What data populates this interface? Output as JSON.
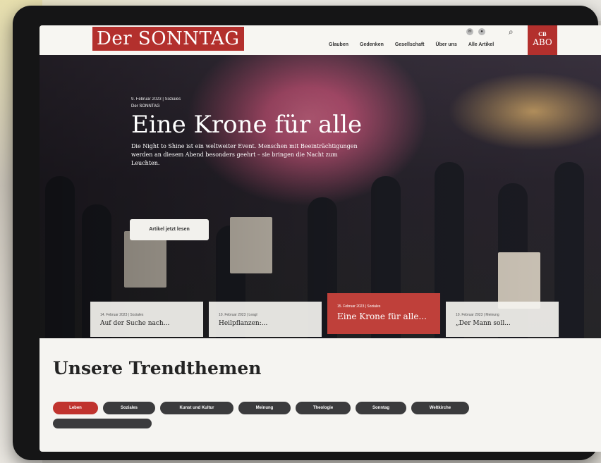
{
  "colors": {
    "brand": "#b3302d",
    "chip_dark": "#3b3b3d"
  },
  "header": {
    "logo": "Der SONNTAG",
    "nav": [
      "Glauben",
      "Gedenken",
      "Gesellschaft",
      "Über uns",
      "Alle Artikel"
    ],
    "abo": {
      "top": "CB",
      "bottom": "ABO"
    }
  },
  "hero": {
    "meta": "9. Februar 2023 | Soziales",
    "author": "Der SONNTAG",
    "title": "Eine Krone für alle",
    "description": "Die Night to Shine ist ein weltweiter Event. Menschen mit Beeinträchtigungen werden an diesem Abend besonders geehrt – sie bringen die Nacht zum Leuchten.",
    "button": "Artikel jetzt lesen"
  },
  "cards": [
    {
      "meta": "14. Februar 2023 | Soziales",
      "title": "Auf der Suche nach..."
    },
    {
      "meta": "10. Februar 2023 | Leagl",
      "title": "Heilpflanzen:..."
    },
    {
      "meta": "15. Februar 2023 | Soziales",
      "title": "Eine Krone für alle..."
    },
    {
      "meta": "10. Februar 2023 | Meinung",
      "title": "„Der Mann soll..."
    }
  ],
  "trends": {
    "title": "Unsere Trendthemen",
    "chips": [
      "Leben",
      "Soziales",
      "Kunst und Kultur",
      "Meinung",
      "Theologie",
      "Sonntag",
      "Weltkirche"
    ]
  }
}
